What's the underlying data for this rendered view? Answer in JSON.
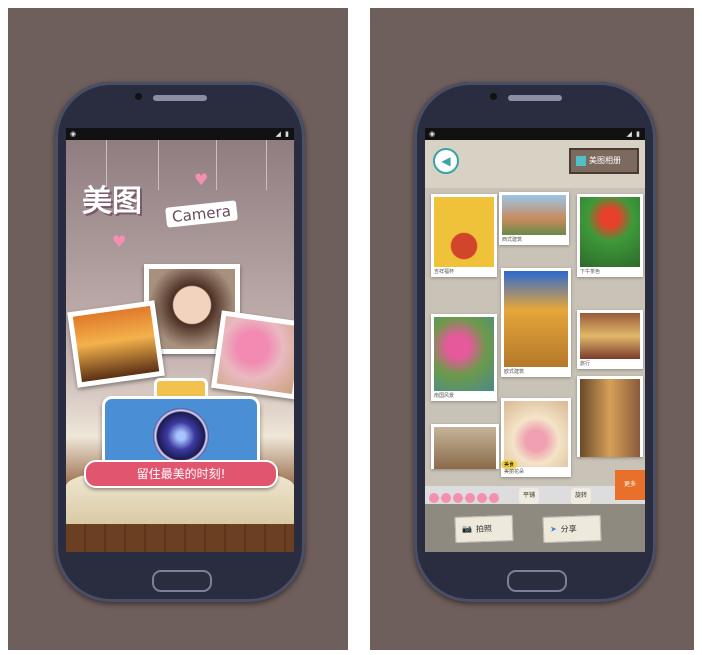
{
  "left_screen": {
    "status_right": "◢ ▮",
    "logo_cn": "美图",
    "logo_en": "Camera",
    "slogan": "留住最美的时刻!"
  },
  "right_screen": {
    "status_right": "◢ ▮",
    "top_button": "美图相册",
    "photo_captions": [
      "吉祥福杯",
      "西式建筑",
      "下午茶色",
      "南国风景",
      "欧式建筑",
      "旅行",
      "美丽花朵"
    ],
    "small_tag": "美食",
    "controls": [
      "平铺",
      "旋转"
    ],
    "orange_tab": "更多",
    "btn_camera": "拍照",
    "btn_share": "分享"
  },
  "colors": {
    "panel_bg": "#6f5f5c",
    "phone_body": "#2a2d40",
    "accent_pink": "#e2556f",
    "accent_teal": "#3aa3a6",
    "camera_blue": "#4a8fd6"
  }
}
